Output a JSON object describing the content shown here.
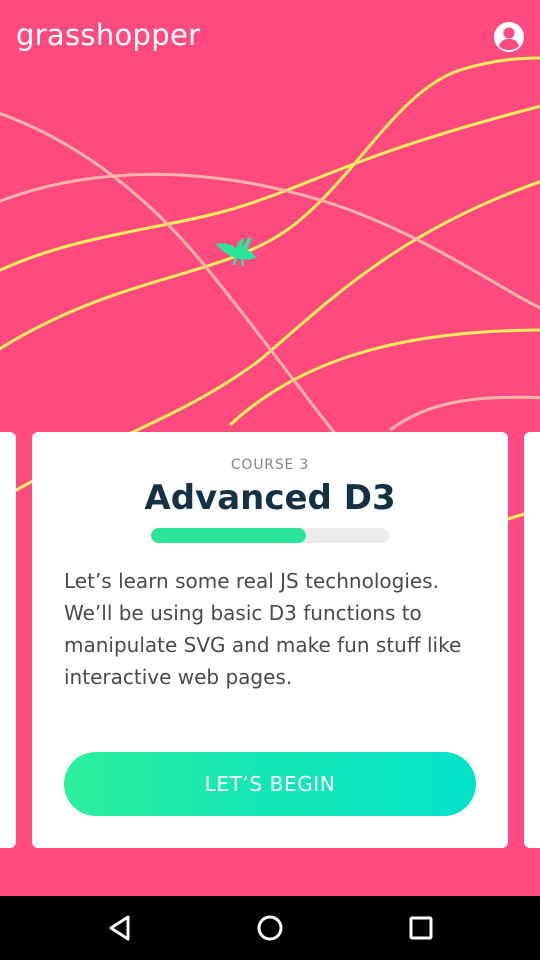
{
  "app": {
    "logo_text": "grasshopper",
    "account_icon": "account-circle-icon"
  },
  "colors": {
    "background": "#ff4a80",
    "curve_yellow": "#f6ef5a",
    "curve_peach": "#ffb5a8",
    "accent_green": "#2ae59a",
    "title_navy": "#143146"
  },
  "course_card": {
    "course_number": "COURSE 3",
    "title": "Advanced D3",
    "progress_fraction": 0.65,
    "description": "Let’s learn some real JS technologies. We’ll be using basic D3 functions to manipulate SVG and make fun stuff like interactive web pages.",
    "begin_label": "LET’S BEGIN"
  },
  "nav_bar": {
    "buttons": [
      "back-triangle-icon",
      "home-circle-icon",
      "recents-square-icon"
    ]
  }
}
